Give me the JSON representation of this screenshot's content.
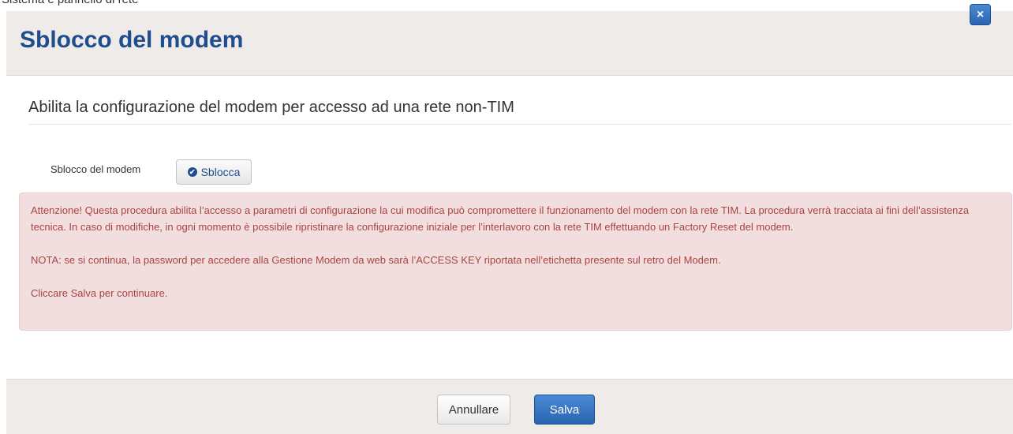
{
  "cropped_top_text": "Sistema e pannello di rete",
  "dialog": {
    "title": "Sblocco del modem",
    "close_symbol": "×"
  },
  "section": {
    "title": "Abilita la configurazione del modem per accesso ad una rete non-TIM"
  },
  "unlock_field": {
    "label": "Sblocco del modem",
    "button_label": "Sblocca",
    "button_icon": "check-circle-icon"
  },
  "alert": {
    "paragraph_1": "Attenzione! Questa procedura abilita l’accesso a parametri di configurazione la cui modifica può compromettere il funzionamento del modem con la rete TIM. La procedura verrà tracciata ai fini dell’assistenza tecnica. In caso di modifiche, in ogni momento è possibile ripristinare la configurazione iniziale per l’interlavoro con la rete TIM effettuando un Factory Reset del modem.",
    "paragraph_2": "NOTA: se si continua, la password per accedere alla Gestione Modem da web sarà l’ACCESS KEY riportata nell’etichetta presente sul retro del Modem.",
    "paragraph_3": "Cliccare Salva per continuare."
  },
  "footer": {
    "cancel_label": "Annullare",
    "save_label": "Salva"
  },
  "colors": {
    "title_blue": "#1f4e8f",
    "header_bg": "#eeebe8",
    "alert_bg": "#f2dede",
    "alert_text": "#a94442",
    "primary_button": "#2a64b0"
  }
}
